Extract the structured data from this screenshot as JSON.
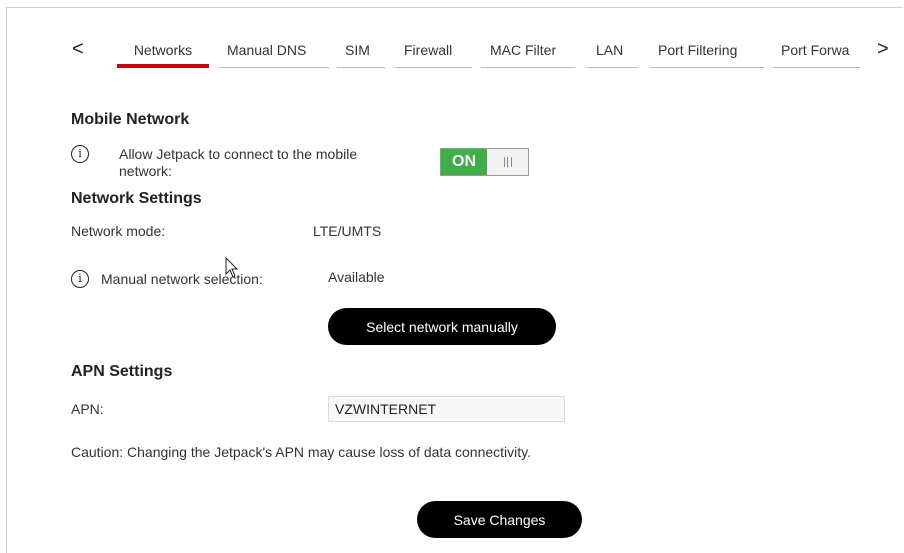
{
  "nav": {
    "prev_symbol": "<",
    "next_symbol": ">",
    "tabs": [
      {
        "label": "Networks",
        "active": true
      },
      {
        "label": "Manual DNS"
      },
      {
        "label": "SIM"
      },
      {
        "label": "Firewall"
      },
      {
        "label": "MAC Filter"
      },
      {
        "label": "LAN"
      },
      {
        "label": "Port Filtering"
      },
      {
        "label": "Port Forwa"
      }
    ]
  },
  "mobile_network": {
    "title": "Mobile Network",
    "allow_label": "Allow Jetpack to connect to the mobile network:",
    "toggle_state": "ON"
  },
  "network_settings": {
    "title": "Network Settings",
    "mode_label": "Network mode:",
    "mode_value": "LTE/UMTS",
    "manual_label": "Manual network selection:",
    "manual_value": "Available",
    "select_button": "Select network manually"
  },
  "apn_settings": {
    "title": "APN Settings",
    "apn_label": "APN:",
    "apn_value": "VZWINTERNET",
    "caution": "Caution: Changing the Jetpack's APN may cause loss of data connectivity."
  },
  "save_button": "Save Changes",
  "icons": {
    "info": "info-icon",
    "prev": "chevron-left-icon",
    "next": "chevron-right-icon"
  },
  "colors": {
    "active_tab": "#cd040b",
    "toggle_on": "#3fae49",
    "button_bg": "#000000"
  }
}
